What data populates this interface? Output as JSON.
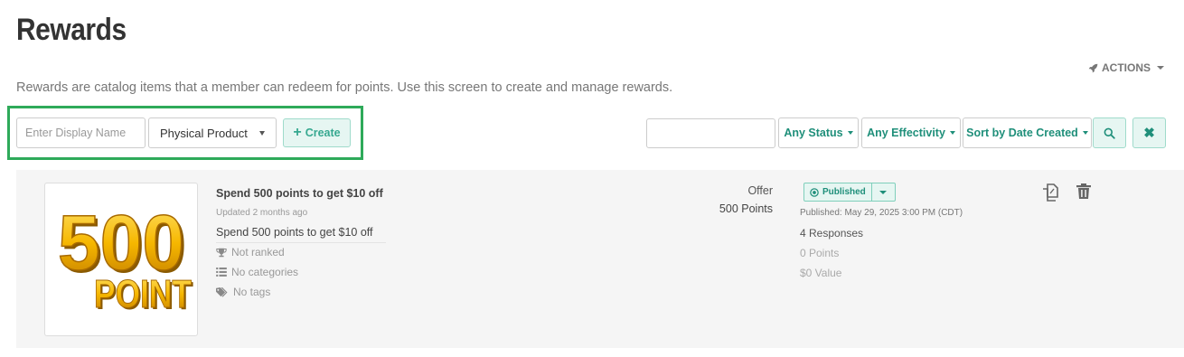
{
  "page": {
    "title": "Rewards",
    "description": "Rewards are catalog items that a member can redeem for points. Use this screen to create and manage rewards.",
    "actions_label": "ACTIONS"
  },
  "create_form": {
    "display_name_placeholder": "Enter Display Name",
    "type_selected": "Physical Product",
    "create_label": "Create"
  },
  "filters": {
    "search_value": "",
    "status_label": "Any Status",
    "effectivity_label": "Any Effectivity",
    "sort_label": "Sort by Date Created"
  },
  "reward": {
    "image_text": "500 POINT",
    "title": "Spend 500 points to get $10 off",
    "updated": "Updated 2 months ago",
    "description": "Spend 500 points to get $10 off",
    "rank": "Not ranked",
    "categories": "No categories",
    "tags": "No tags",
    "offer_label": "Offer",
    "offer_points": "500 Points",
    "status": "Published",
    "published_date": "Published: May 29, 2025 3:00 PM (CDT)",
    "responses": "4 Responses",
    "points_total": "0 Points",
    "value_total": "$0 Value"
  },
  "colors": {
    "accent": "#1f8f7a",
    "accent_light_bg": "#e6f6f2",
    "highlight_border": "#2eaa5a",
    "card_bg": "#f5f5f5"
  }
}
